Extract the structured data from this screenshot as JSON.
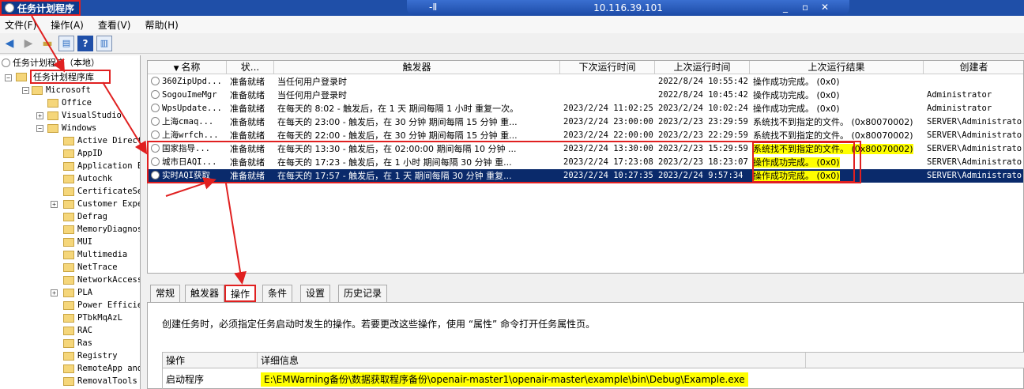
{
  "window": {
    "title": "任务计划程序",
    "remote_host": "10.116.39.101",
    "remote_pin": "-Ⅱ",
    "remote_controls": [
      "_",
      "▫",
      "✕"
    ]
  },
  "menu": [
    "文件(F)",
    "操作(A)",
    "查看(V)",
    "帮助(H)"
  ],
  "toolbar_icons": [
    "back-arrow-icon",
    "forward-arrow-icon",
    "folder-up-icon",
    "properties-icon",
    "help-icon",
    "pane-icon"
  ],
  "tree": {
    "root": "任务计划程序（本地）",
    "library": "任务计划程序库",
    "items": [
      {
        "label": "Microsoft"
      },
      {
        "label": "Office"
      },
      {
        "label": "VisualStudio"
      },
      {
        "label": "Windows"
      },
      {
        "label": "Active Direct"
      },
      {
        "label": "AppID"
      },
      {
        "label": "Application E"
      },
      {
        "label": "Autochk"
      },
      {
        "label": "CertificateSe"
      },
      {
        "label": "Customer Expe"
      },
      {
        "label": "Defrag"
      },
      {
        "label": "MemoryDiagnos"
      },
      {
        "label": "MUI"
      },
      {
        "label": "Multimedia"
      },
      {
        "label": "NetTrace"
      },
      {
        "label": "NetworkAccess"
      },
      {
        "label": "PLA"
      },
      {
        "label": "Power Efficie"
      },
      {
        "label": "PTbkMqAzL"
      },
      {
        "label": "RAC"
      },
      {
        "label": "Ras"
      },
      {
        "label": "Registry"
      },
      {
        "label": "RemoteApp and"
      },
      {
        "label": "RemovalTools"
      }
    ]
  },
  "list": {
    "columns": [
      "名称",
      "状...",
      "触发器",
      "下次运行时间",
      "上次运行时间",
      "上次运行结果",
      "创建者"
    ],
    "rows": [
      {
        "name": "360ZipUpd...",
        "status": "准备就绪",
        "trigger": "当任何用户登录时",
        "next": "",
        "last": "2022/8/24 10:55:42",
        "result": "操作成功完成。 (0x0)",
        "author": ""
      },
      {
        "name": "SogouImeMgr",
        "status": "准备就绪",
        "trigger": "当任何用户登录时",
        "next": "",
        "last": "2022/8/24 10:45:42",
        "result": "操作成功完成。 (0x0)",
        "author": "Administrator"
      },
      {
        "name": "WpsUpdate...",
        "status": "准备就绪",
        "trigger": "在每天的 8:02 - 触发后，在 1 天 期间每隔 1 小时 重复一次。",
        "next": "2023/2/24 11:02:25",
        "last": "2023/2/24 10:02:24",
        "result": "操作成功完成。 (0x0)",
        "author": "Administrator"
      },
      {
        "name": "上海cmaq...",
        "status": "准备就绪",
        "trigger": "在每天的 23:00 - 触发后，在 30 分钟 期间每隔 15 分钟 重...",
        "next": "2023/2/24 23:00:00",
        "last": "2023/2/23 23:29:59",
        "result": "系统找不到指定的文件。 (0x80070002)",
        "author": "SERVER\\Administrato"
      },
      {
        "name": "上海wrfch...",
        "status": "准备就绪",
        "trigger": "在每天的 22:00 - 触发后，在 30 分钟 期间每隔 15 分钟 重...",
        "next": "2023/2/24 22:00:00",
        "last": "2023/2/23 22:29:59",
        "result": "系统找不到指定的文件。 (0x80070002)",
        "author": "SERVER\\Administrato"
      },
      {
        "name": "国家指导...",
        "status": "准备就绪",
        "trigger": "在每天的 13:30 - 触发后，在 02:00:00 期间每隔 10 分钟 ...",
        "next": "2023/2/24 13:30:00",
        "last": "2023/2/23 15:29:59",
        "result": "系统找不到指定的文件。 (0x80070002)",
        "author": "SERVER\\Administrato"
      },
      {
        "name": "城市日AQI...",
        "status": "准备就绪",
        "trigger": "在每天的 17:23 - 触发后，在 1 小时 期间每隔 30 分钟 重...",
        "next": "2023/2/24 17:23:08",
        "last": "2023/2/23 18:23:07",
        "result": "操作成功完成。 (0x0)",
        "author": "SERVER\\Administrato"
      },
      {
        "name": "实时AQI获取",
        "status": "准备就绪",
        "trigger": "在每天的 17:57 - 触发后，在 1 天 期间每隔 30 分钟 重复...",
        "next": "2023/2/24 10:27:35",
        "last": "2023/2/24 9:57:34",
        "result": "操作成功完成。 (0x0)",
        "author": "SERVER\\Administrato"
      }
    ]
  },
  "tabs": [
    "常规",
    "触发器",
    "操作",
    "条件",
    "设置",
    "历史记录"
  ],
  "detail": {
    "description": "创建任务时，必须指定任务启动时发生的操作。若要更改这些操作，使用 “属性” 命令打开任务属性页。",
    "col_action": "操作",
    "col_detail": "详细信息",
    "action": "启动程序",
    "path": "E:\\EMWarning备份\\数据获取程序备份\\openair-master1\\openair-master\\example\\bin\\Debug\\Example.exe"
  },
  "colors": {
    "highlight": "#ffff00",
    "annotation": "#e02020",
    "selection": "#0a2a6b"
  }
}
